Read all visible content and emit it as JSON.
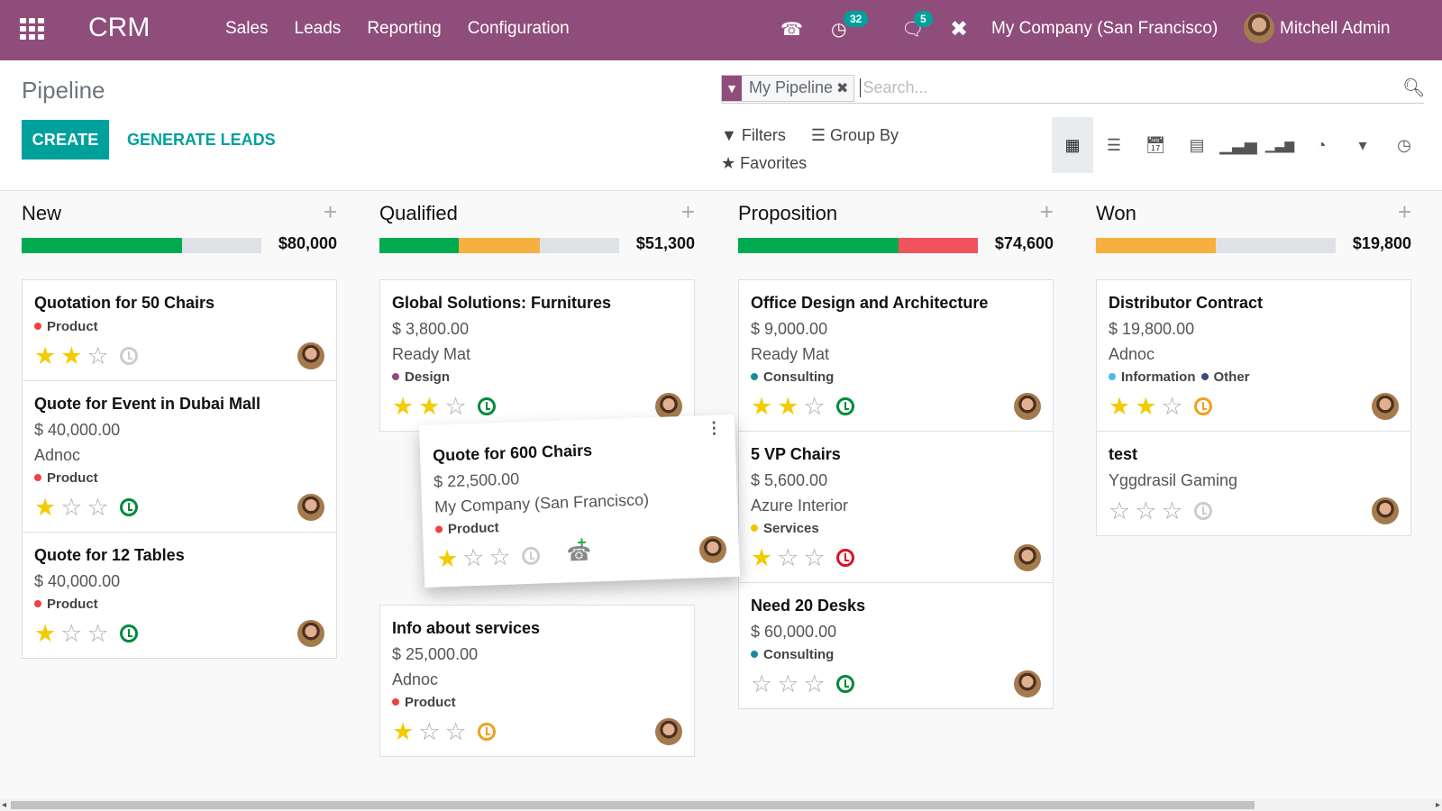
{
  "navbar": {
    "brand": "CRM",
    "menu": [
      "Sales",
      "Leads",
      "Reporting",
      "Configuration"
    ],
    "activity_count": "32",
    "message_count": "5",
    "company": "My Company (San Francisco)",
    "user": "Mitchell Admin",
    "color": "#8f4d7b"
  },
  "control": {
    "title": "Pipeline",
    "create_label": "CREATE",
    "generate_label": "GENERATE LEADS",
    "facet_label": "My Pipeline",
    "search_placeholder": "Search...",
    "filters_label": "Filters",
    "groupby_label": "Group By",
    "favorites_label": "Favorites",
    "views": [
      "kanban",
      "list",
      "calendar",
      "pivot",
      "graph",
      "cohort",
      "dashboard",
      "map",
      "activity"
    ],
    "active_view": "kanban",
    "accent": "#00a09d"
  },
  "columns": [
    {
      "title": "New",
      "total": "$80,000",
      "progress": [
        {
          "color": "#00aa4f",
          "fraction": 0.67
        }
      ],
      "cards": [
        {
          "title": "Quotation for 50 Chairs",
          "amount": "",
          "company": "",
          "tags": [
            {
              "label": "Product",
              "color": "#f04040"
            }
          ],
          "stars": 2,
          "activity": "none"
        },
        {
          "title": "Quote for Event in Dubai Mall",
          "amount": "$ 40,000.00",
          "company": "Adnoc",
          "tags": [
            {
              "label": "Product",
              "color": "#f04040"
            }
          ],
          "stars": 1,
          "activity": "planned"
        },
        {
          "title": "Quote for 12 Tables",
          "amount": "$ 40,000.00",
          "company": "",
          "tags": [
            {
              "label": "Product",
              "color": "#f04040"
            }
          ],
          "stars": 1,
          "activity": "planned"
        }
      ]
    },
    {
      "title": "Qualified",
      "total": "$51,300",
      "progress": [
        {
          "color": "#00aa4f",
          "fraction": 0.33
        },
        {
          "color": "#f7b040",
          "fraction": 0.34
        }
      ],
      "cards": [
        {
          "title": "Global Solutions: Furnitures",
          "amount": "$ 3,800.00",
          "company": "Ready Mat",
          "tags": [
            {
              "label": "Design",
              "color": "#8f4d7b"
            }
          ],
          "stars": 2,
          "activity": "planned"
        },
        {
          "spacer": true
        },
        {
          "title": "Info about services",
          "amount": "$ 25,000.00",
          "company": "Adnoc",
          "tags": [
            {
              "label": "Product",
              "color": "#f04040"
            }
          ],
          "stars": 1,
          "activity": "today"
        }
      ]
    },
    {
      "title": "Proposition",
      "total": "$74,600",
      "progress": [
        {
          "color": "#00aa4f",
          "fraction": 0.67
        },
        {
          "color": "#f0525e",
          "fraction": 0.33
        }
      ],
      "cards": [
        {
          "title": "Office Design and Architecture",
          "amount": "$ 9,000.00",
          "company": "Ready Mat",
          "tags": [
            {
              "label": "Consulting",
              "color": "#1b8a9b"
            }
          ],
          "stars": 2,
          "activity": "planned"
        },
        {
          "title": "5 VP Chairs",
          "amount": "$ 5,600.00",
          "company": "Azure Interior",
          "tags": [
            {
              "label": "Services",
              "color": "#f0c800"
            }
          ],
          "stars": 1,
          "activity": "overdue"
        },
        {
          "title": "Need 20 Desks",
          "amount": "$ 60,000.00",
          "company": "",
          "tags": [
            {
              "label": "Consulting",
              "color": "#1b8a9b"
            }
          ],
          "stars": 0,
          "activity": "planned"
        }
      ]
    },
    {
      "title": "Won",
      "total": "$19,800",
      "progress": [
        {
          "color": "#f7b040",
          "fraction": 0.5
        }
      ],
      "cards": [
        {
          "title": "Distributor Contract",
          "amount": "$ 19,800.00",
          "company": "Adnoc",
          "tags": [
            {
              "label": "Information",
              "color": "#4fb6ef"
            },
            {
              "label": "Other",
              "color": "#3f4a7a"
            }
          ],
          "stars": 2,
          "activity": "today"
        },
        {
          "title": "test",
          "amount": "",
          "company": "Yggdrasil Gaming",
          "tags": [],
          "stars": 0,
          "activity": "none"
        }
      ]
    }
  ],
  "dragged_card": {
    "title": "Quote for 600 Chairs",
    "amount": "$ 22,500.00",
    "company": "My Company (San Francisco)",
    "tags": [
      {
        "label": "Product",
        "color": "#f04040"
      }
    ],
    "stars": 1,
    "activity": "none"
  },
  "activity_colors": {
    "none": "#cccccc",
    "planned": "#008a3b",
    "today": "#f0a020",
    "overdue": "#e01020"
  }
}
